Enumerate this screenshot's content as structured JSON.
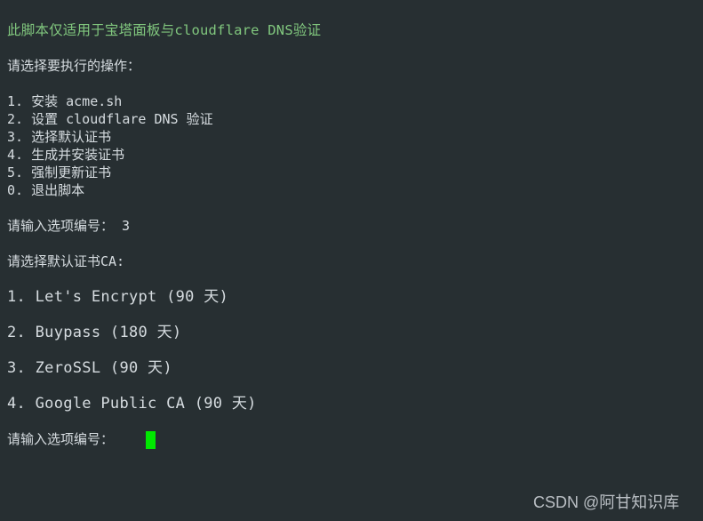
{
  "terminal": {
    "background_color": "#272f32",
    "foreground_color": "#d6dce0",
    "accent_green": "#81c77e",
    "cursor_color": "#00e800",
    "banner": "此脚本仅适用于宝塔面板与cloudflare DNS验证",
    "prompt_operation": "请选择要执行的操作：",
    "menu": [
      {
        "key": "1.",
        "label": "安装 acme.sh"
      },
      {
        "key": "2.",
        "label": "设置 cloudflare DNS 验证"
      },
      {
        "key": "3.",
        "label": "选择默认证书"
      },
      {
        "key": "4.",
        "label": "生成并安装证书"
      },
      {
        "key": "5.",
        "label": "强制更新证书"
      },
      {
        "key": "0.",
        "label": "退出脚本"
      }
    ],
    "input_prompt_1": "请输入选项编号：",
    "input_value_1": "3",
    "prompt_ca": "请选择默认证书CA:",
    "ca_options": [
      {
        "key": "1.",
        "label": "Let's Encrypt (90 天)"
      },
      {
        "key": "2.",
        "label": "Buypass (180 天)"
      },
      {
        "key": "3.",
        "label": "ZeroSSL (90 天)"
      },
      {
        "key": "4.",
        "label": "Google Public CA (90 天)"
      }
    ],
    "input_prompt_2": "请输入选项编号：",
    "input_value_2": "",
    "cursor": "block-cursor"
  },
  "watermark": {
    "text": "CSDN @阿甘知识库"
  }
}
